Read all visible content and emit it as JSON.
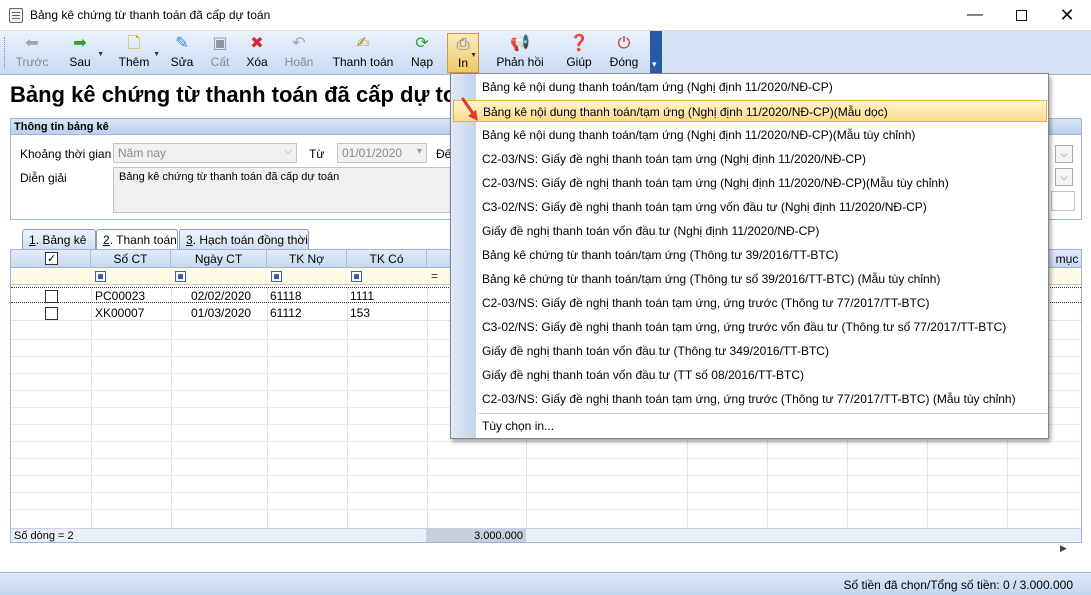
{
  "window": {
    "title": "Bảng kê chứng từ thanh toán đã cấp dự toán"
  },
  "toolbar": {
    "back": "Trước",
    "next": "Sau",
    "add": "Thêm",
    "edit": "Sửa",
    "save": "Cất",
    "delete": "Xóa",
    "undo": "Hoãn",
    "pay": "Thanh toán",
    "load": "Nạp",
    "print": "In",
    "feedback": "Phản hồi",
    "help": "Giúp",
    "close": "Đóng"
  },
  "page": {
    "title": "Bảng kê chứng từ thanh toán đã cấp dự toán"
  },
  "info": {
    "section_title": "Thông tin bảng kê",
    "period_label": "Khoảng thời gian",
    "period_value": "Năm nay",
    "from_label": "Từ",
    "from_value": "01/01/2020",
    "to_label": "Đế",
    "desc_label": "Diễn giải",
    "desc_value": "Bảng kê chứng từ thanh toán đã cấp dự toán"
  },
  "tabs": [
    {
      "num": "1",
      "label": ". Bảng kê"
    },
    {
      "num": "2",
      "label": ". Thanh toán"
    },
    {
      "num": "3",
      "label": ". Hạch toán đồng thời"
    }
  ],
  "grid": {
    "columns": [
      "Số CT",
      "Ngày CT",
      "TK Nợ",
      "TK Có",
      "mục"
    ],
    "rows": [
      {
        "so_ct": "PC00023",
        "ngay_ct": "02/02/2020",
        "tk_no": "61118",
        "tk_co": "1111"
      },
      {
        "so_ct": "XK00007",
        "ngay_ct": "01/03/2020",
        "tk_no": "61112",
        "tk_co": "153"
      }
    ],
    "footer_count": "Số dòng = 2",
    "footer_total": "3.000.000"
  },
  "status": {
    "text": "Số tiền đã chọn/Tổng số tiền: 0 / 3.000.000"
  },
  "print_menu": {
    "items": [
      "Bảng kê nội dung thanh toán/tạm ứng (Nghị định 11/2020/NĐ-CP)",
      "Bảng kê nội dung thanh toán/tạm ứng (Nghị định 11/2020/NĐ-CP)(Mẫu dọc)",
      "Bảng kê nội dung thanh toán/tạm ứng (Nghị định 11/2020/NĐ-CP)(Mẫu tùy chỉnh)",
      "C2-03/NS: Giấy đề nghị thanh toán tạm ứng (Nghị định 11/2020/NĐ-CP)",
      "C2-03/NS: Giấy đề nghị thanh toán tạm ứng (Nghị định 11/2020/NĐ-CP)(Mẫu tùy chỉnh)",
      "C3-02/NS: Giấy đề nghị thanh toán tạm ứng vốn đầu tư (Nghị định 11/2020/NĐ-CP)",
      "Giấy đề nghị thanh toán vốn đầu tư (Nghị định 11/2020/NĐ-CP)",
      "Bảng kê chứng từ thanh toán/tạm ứng (Thông tư 39/2016/TT-BTC)",
      "Bảng kê chứng từ thanh toán/tạm ứng (Thông tư số 39/2016/TT-BTC) (Mẫu tùy chỉnh)",
      "C2-03/NS: Giấy đề nghị thanh toán tạm ứng, ứng trước (Thông tư 77/2017/TT-BTC)",
      "C3-02/NS: Giấy đề nghị thanh toán tạm ứng, ứng trước vốn đầu tư (Thông tư số 77/2017/TT-BTC)",
      "Giấy đề nghị thanh toán vốn đầu tư (Thông tư 349/2016/TT-BTC)",
      "Giấy đề nghị thanh toán vốn đầu tư (TT số 08/2016/TT-BTC)",
      "C2-03/NS: Giấy đề nghị thanh toán tạm ứng, ứng trước (Thông tư 77/2017/TT-BTC) (Mẫu tùy chỉnh)"
    ],
    "highlighted_index": 1,
    "options": "Tùy chọn in..."
  },
  "colors": {
    "accent": "#2a5aa5",
    "highlight": "#fbdc8e",
    "arrow": "#e03a2e"
  }
}
